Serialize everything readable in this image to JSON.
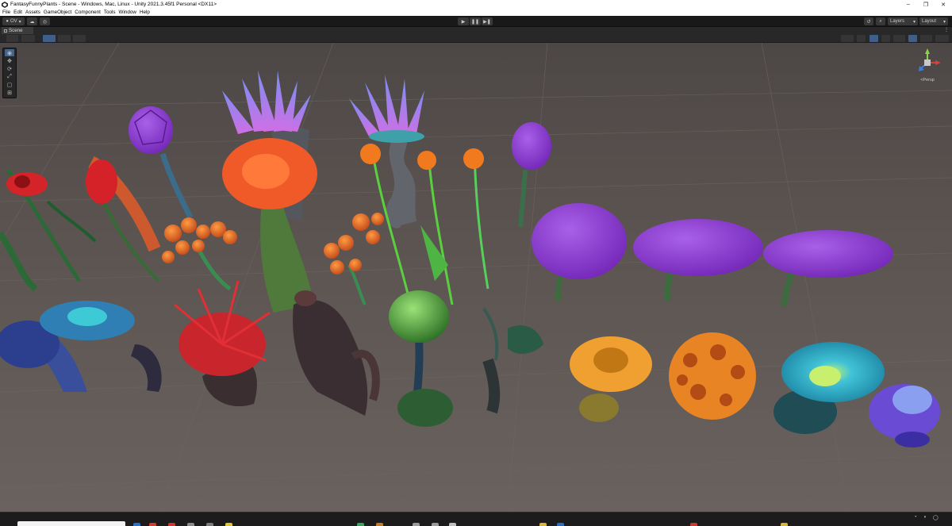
{
  "window": {
    "title": "FantasyFunnyPlants - Scene - Windows, Mac, Linux - Unity 2021.3.45f1 Personal <DX11>",
    "controls": [
      "–",
      "❐",
      "✕"
    ]
  },
  "menu": [
    "File",
    "Edit",
    "Assets",
    "GameObject",
    "Component",
    "Tools",
    "Window",
    "Help"
  ],
  "toolbar": {
    "account_label": "OV",
    "play_icon": "▶",
    "pause_icon": "❚❚",
    "step_icon": "▶❚",
    "layers_label": "Layers",
    "layout_label": "Layout"
  },
  "scene_tab": {
    "label": "Scene"
  },
  "gizmo": {
    "label": "<Persp"
  },
  "colors": {
    "accent": "#3d5f8a",
    "ground": "#5e5450",
    "sky": "#4f4a48",
    "purple_cap": "#9138d6",
    "orange": "#ff5b2d"
  }
}
